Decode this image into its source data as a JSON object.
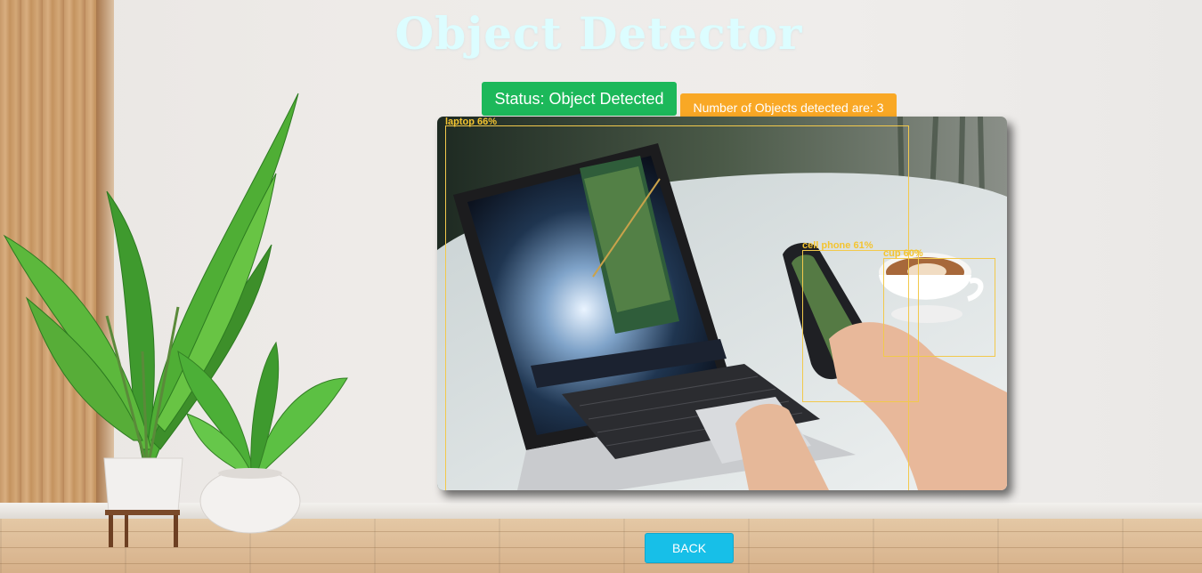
{
  "page": {
    "title": "Object Detector",
    "title_color": "#dcfdff"
  },
  "status": {
    "label": "Status: Object Detected",
    "color": "#1cb85a"
  },
  "count": {
    "label": "Number of Objects detected are: 3",
    "color": "#f9a825"
  },
  "detections": [
    {
      "label": "laptop 66%",
      "class": "laptop",
      "confidence": 66
    },
    {
      "label": "cell phone 61%",
      "class": "cell phone",
      "confidence": 61
    },
    {
      "label": "cup 60%",
      "class": "cup",
      "confidence": 60
    }
  ],
  "box_color": "#f2c94c",
  "actions": {
    "back_label": "BACK",
    "back_color": "#17bfe8"
  }
}
